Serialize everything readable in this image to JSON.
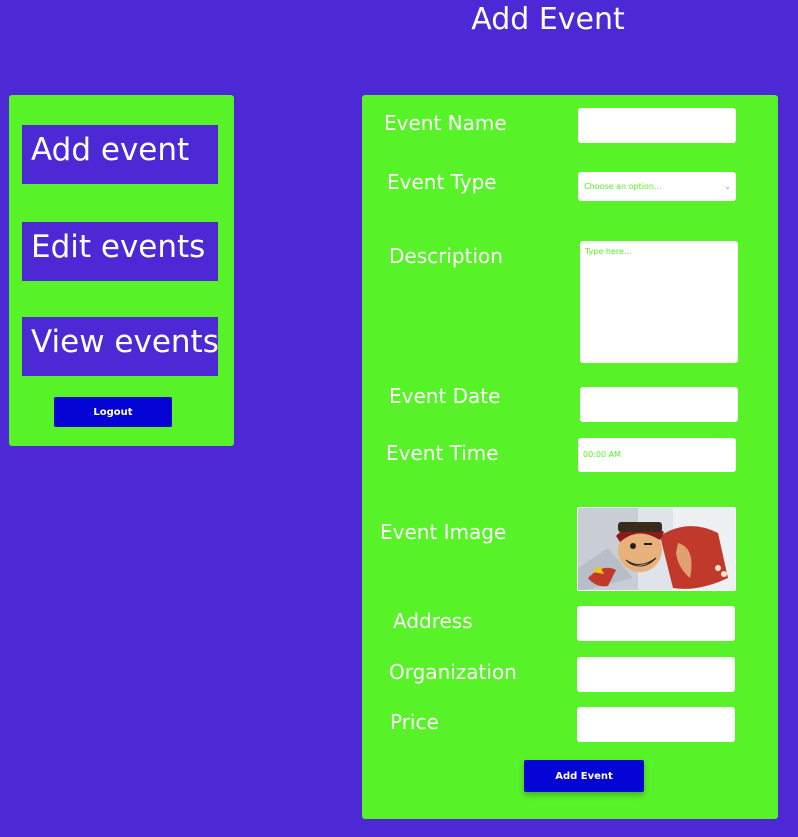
{
  "page": {
    "title": "Add Event"
  },
  "sidebar": {
    "items": [
      {
        "label": "Add event"
      },
      {
        "label": "Edit events"
      },
      {
        "label": "View events"
      }
    ],
    "logout_label": "Logout"
  },
  "form": {
    "event_name": {
      "label": "Event Name",
      "value": ""
    },
    "event_type": {
      "label": "Event Type",
      "placeholder": "Choose an option..."
    },
    "description": {
      "label": "Description",
      "placeholder": "Type here..."
    },
    "event_date": {
      "label": "Event Date",
      "value": ""
    },
    "event_time": {
      "label": "Event Time",
      "value": "00:00 AM"
    },
    "event_image": {
      "label": "Event Image"
    },
    "address": {
      "label": "Address",
      "value": ""
    },
    "organization": {
      "label": "Organization",
      "value": ""
    },
    "price": {
      "label": "Price",
      "value": ""
    },
    "submit_label": "Add Event"
  },
  "colors": {
    "background": "#4d29d6",
    "panel": "#58f228",
    "button": "#0303d3",
    "text": "#ffffff"
  }
}
